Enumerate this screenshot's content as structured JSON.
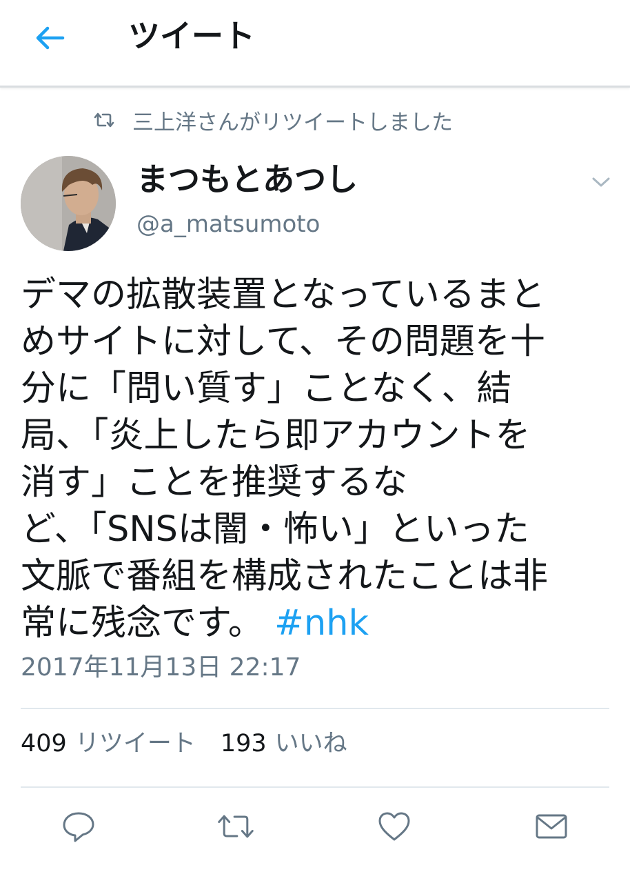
{
  "header": {
    "title": "ツイート",
    "back_icon": "arrow-left-icon",
    "accent_color": "#1da1f2"
  },
  "retweet_notice": {
    "icon": "retweet-icon",
    "text": "三上洋さんがリツイートしました"
  },
  "author": {
    "display_name": "まつもとあつし",
    "handle": "@a_matsumoto"
  },
  "tweet": {
    "lines": [
      "デマの拡散装置となっているまと",
      "めサイトに対して、その問題を十",
      "分に「問い質す」ことなく、結",
      "局、「炎上したら即アカウントを",
      "消す」ことを推奨するな",
      "ど、「SNSは闇・怖い」といった",
      "文脈で番組を構成されたことは非"
    ],
    "last_line_text": "常に残念です。",
    "hashtag": "#nhk",
    "timestamp": "2017年11月13日 22:17"
  },
  "stats": {
    "retweet_count": "409",
    "retweet_label": "リツイート",
    "like_count": "193",
    "like_label": "いいね"
  },
  "actions": {
    "reply_icon": "reply-icon",
    "retweet_icon": "retweet-icon",
    "like_icon": "heart-icon",
    "dm_icon": "envelope-icon"
  }
}
